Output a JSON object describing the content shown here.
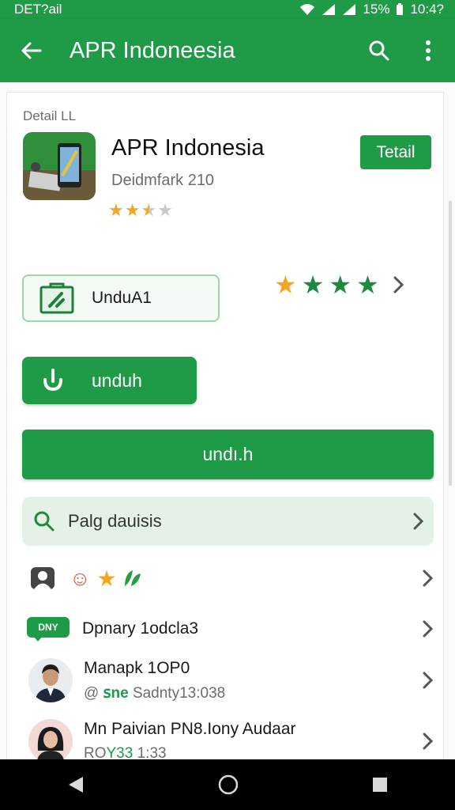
{
  "status_bar": {
    "left_text": "DET?ail",
    "battery": "15%",
    "time": "10:4?"
  },
  "app_bar": {
    "title": "APR Indoneesia"
  },
  "detail": {
    "section_label": "Detail LL",
    "app_name": "APR Indonesia",
    "subtitle": "Deidmfark 210",
    "rating_stars": 2.5,
    "detail_button": "Tetail"
  },
  "actions": {
    "outline_button": "UnduA1",
    "rating_stars": 4,
    "download_button": "unduh",
    "wide_button": "undı.h"
  },
  "search": {
    "text": "Palg dauisis"
  },
  "list": {
    "row2_title": "Dpnary  1odcla3",
    "row2_badge": "DNY",
    "row3_title": "Manapk 1OP0",
    "row3_at": "@",
    "row3_tag": "ꜱne",
    "row3_sub": "Sadnty13:038",
    "row4_title": "Mn Paivian PN8.Iony Audaar",
    "row4_tag": "RO",
    "row4_tag2": "Y33",
    "row4_sub": "1:33"
  },
  "colors": {
    "brand": "#1f9a46",
    "star": "#f4a623",
    "search_bg": "#e4f1e7"
  }
}
